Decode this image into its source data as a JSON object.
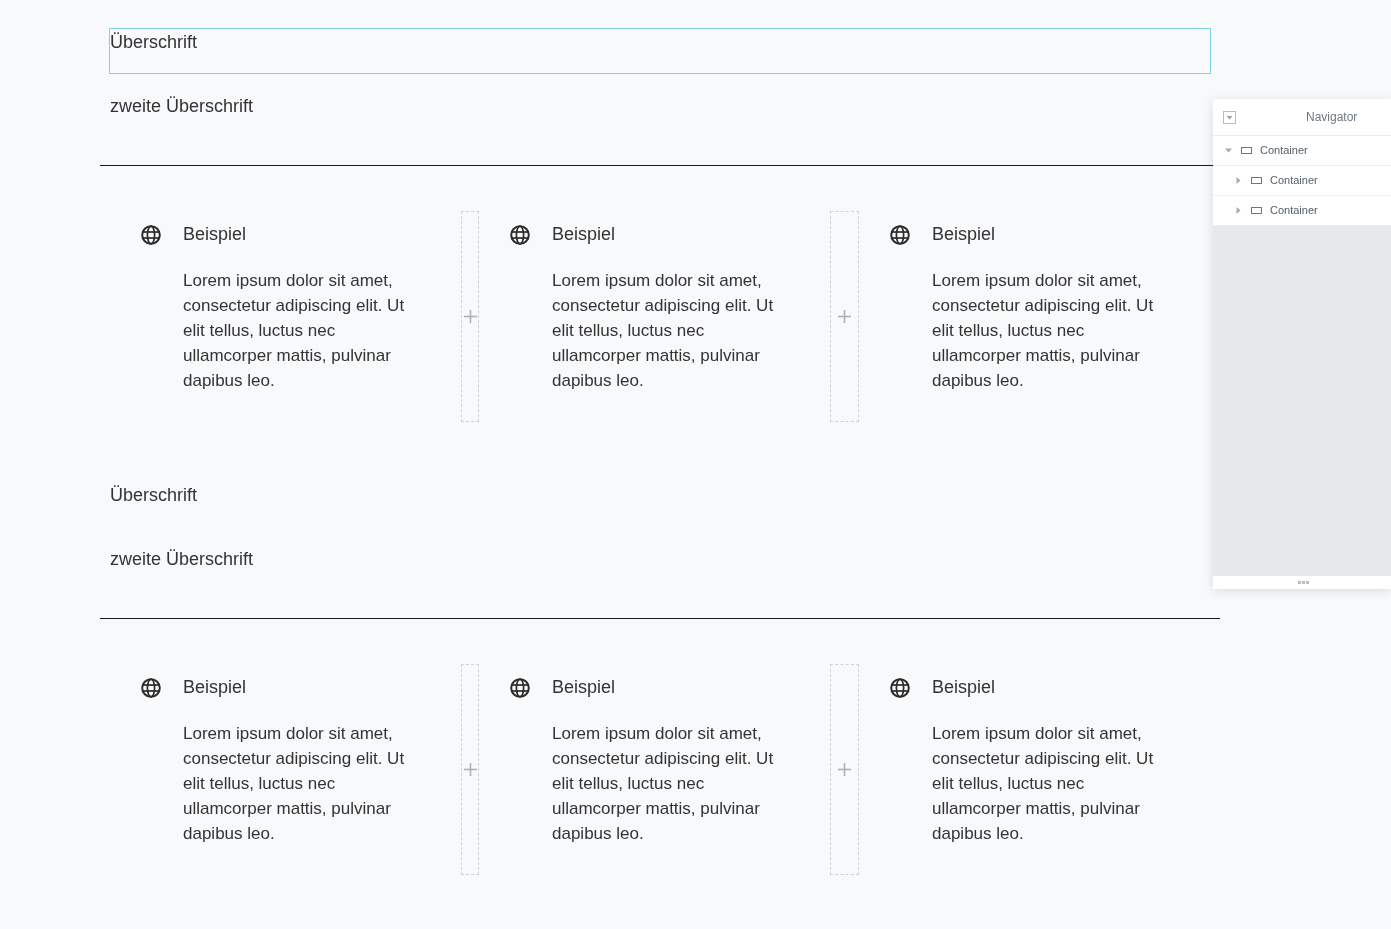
{
  "sections": [
    {
      "heading": {
        "text": "Überschrift",
        "selected": true
      },
      "subheading": "zweite Überschrift",
      "boxes": [
        {
          "title": "Beispiel",
          "text": "Lorem ipsum dolor sit amet, consectetur adipiscing elit. Ut elit tellus, luctus nec ullamcorper mattis, pulvinar dapibus leo."
        },
        {
          "title": "Beispiel",
          "text": "Lorem ipsum dolor sit amet, consectetur adipiscing elit. Ut elit tellus, luctus nec ullamcorper mattis, pulvinar dapibus leo."
        },
        {
          "title": "Beispiel",
          "text": "Lorem ipsum dolor sit amet, consectetur adipiscing elit. Ut elit tellus, luctus nec ullamcorper mattis, pulvinar dapibus leo."
        }
      ]
    },
    {
      "heading": {
        "text": "Überschrift",
        "selected": false
      },
      "subheading": "zweite Überschrift",
      "boxes": [
        {
          "title": "Beispiel",
          "text": "Lorem ipsum dolor sit amet, consectetur adipiscing elit. Ut elit tellus, luctus nec ullamcorper mattis, pulvinar dapibus leo."
        },
        {
          "title": "Beispiel",
          "text": "Lorem ipsum dolor sit amet, consectetur adipiscing elit. Ut elit tellus, luctus nec ullamcorper mattis, pulvinar dapibus leo."
        },
        {
          "title": "Beispiel",
          "text": "Lorem ipsum dolor sit amet, consectetur adipiscing elit. Ut elit tellus, luctus nec ullamcorper mattis, pulvinar dapibus leo."
        }
      ]
    }
  ],
  "navigator": {
    "title": "Navigator",
    "items": [
      {
        "label": "Container",
        "expanded": true,
        "children": [
          {
            "label": "Container",
            "expanded": false
          },
          {
            "label": "Container",
            "expanded": false
          }
        ]
      }
    ]
  }
}
